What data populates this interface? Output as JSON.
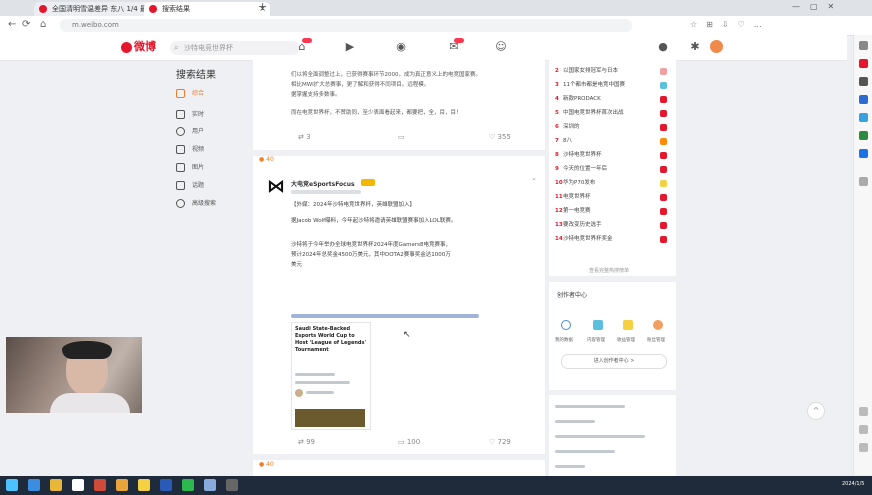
{
  "browser": {
    "tabs": [
      {
        "label": "全国清明雪温差异 东八 1/4 最低温",
        "active": false
      },
      {
        "label": "搜索结果",
        "active": true
      }
    ],
    "new_tab": "+",
    "url": "m.weibo.com",
    "nav": {
      "back": "←",
      "forward": "→",
      "reload": "⟳",
      "home": "⌂"
    }
  },
  "weibo": {
    "logo_text": "微博",
    "search_placeholder": "沙特电竞世界杯",
    "page_heading": "搜索结果",
    "left_nav": [
      {
        "label": "综合",
        "active": true
      },
      {
        "label": "实时"
      },
      {
        "label": "用户"
      },
      {
        "label": "视频"
      },
      {
        "label": "图片"
      },
      {
        "label": "话题"
      },
      {
        "label": "高级搜索"
      }
    ],
    "post1": {
      "text_lines": [
        "们以将全面调整过上，已获得赛事环节2000，成为真正意义上的电竞国家赛。",
        "相比MWI扩大总赛事，更了解和获得不同项目。远程模。",
        "据掌握支持多数事。"
      ],
      "tail_text": "而在电竞世界杯，不赞助同，至少表面看起来，都要把，全，目，目！",
      "actions": {
        "repost": "3",
        "comment": "",
        "like": "355"
      }
    },
    "post2": {
      "group_label": "40",
      "author": "大电竞eSportsFocus",
      "author_badge": "",
      "meta": "",
      "headline": "【外媒：2024年沙特电竞世界杯，英雄联盟加入】",
      "body_lines": [
        "据Jacob Wolf曝料，今年起沙特将邀请英雄联盟赛事加入LOL联赛。",
        "沙特将于今年举办全球电竞世界杯2024年度Gamers8电竞赛事，",
        "预计2024年总奖金4500万美元，其中DOTA2赛事奖金达1000万",
        "美元"
      ],
      "link_text": "",
      "card_headline": "Saudi State-Backed Esports World Cup to Host 'League of Legends' Tournament",
      "actions": {
        "repost": "99",
        "comment": "100",
        "like": "729"
      }
    },
    "post3_label": "40",
    "hot_list": [
      {
        "rank": "2",
        "text": "以国家女排冠军与日本"
      },
      {
        "rank": "3",
        "text": "11个都市都是电竞中国赛"
      },
      {
        "rank": "4",
        "text": "新款PRODACK"
      },
      {
        "rank": "5",
        "text": "中国电竞世界杯首次出战"
      },
      {
        "rank": "6",
        "text": "深圳的"
      },
      {
        "rank": "7",
        "text": "8八"
      },
      {
        "rank": "8",
        "text": "沙特电竞世界杯"
      },
      {
        "rank": "9",
        "text": "今天的位置一年后"
      },
      {
        "rank": "10",
        "text": "华为P70发布"
      },
      {
        "rank": "11",
        "text": "电竞世界杯"
      },
      {
        "rank": "12",
        "text": "第一电竞赛"
      },
      {
        "rank": "13",
        "text": "要改变历史选手"
      },
      {
        "rank": "14",
        "text": "沙特电竞世界杯奖金"
      }
    ],
    "hot_more": "查看完整热搜榜单",
    "creator": {
      "title": "创作者中心",
      "items": [
        "我的数据",
        "内容管理",
        "收益管理",
        "粉丝管理"
      ],
      "cta": "进入创作者中心 >"
    },
    "misc_lines": [
      "",
      "",
      "",
      "",
      ""
    ],
    "scroll_top": "^"
  },
  "colors": {
    "brand": "#e6162d",
    "link": "#eb7350",
    "hot_tags": [
      "#f0a0a0",
      "#5bc0de",
      "#e6162d",
      "#e6162d",
      "#e6162d",
      "#ff8c00",
      "#e6162d",
      "#e6162d",
      "#f5d142",
      "#e6162d",
      "#e6162d",
      "#e6162d",
      "#e6162d"
    ]
  },
  "taskbar": {
    "clock": "2024/1/5"
  }
}
